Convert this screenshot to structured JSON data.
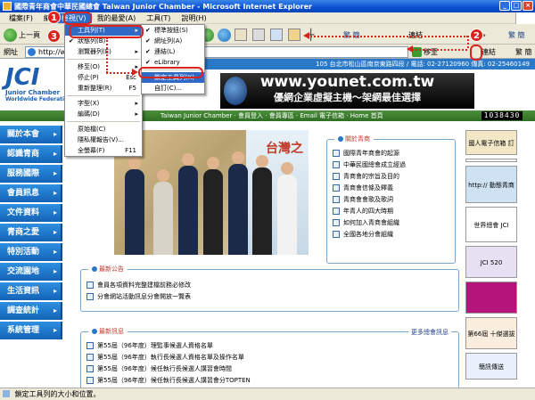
{
  "window": {
    "title": "國際青年商會中華民國總會 Taiwan Junior Chamber - Microsoft Internet Explorer",
    "controls": [
      "_",
      "□",
      "×"
    ]
  },
  "menubar": {
    "items": [
      "檔案(F)",
      "編",
      "檢視(V)",
      "我的最愛(A)",
      "工具(T)",
      "說明(H)"
    ]
  },
  "toolbar": {
    "back_label": "上一頁",
    "links_label": "連結",
    "extra_label": "繁 簡"
  },
  "address_bar": {
    "label": "網址",
    "url": "http://www",
    "go_label": "移至",
    "links_label": "連結",
    "links_extra": "繁 簡"
  },
  "view_menu": {
    "items": [
      {
        "label": "工具列(T)",
        "arrow": true,
        "highlighted": true
      },
      {
        "label": "狀態列(B)",
        "check": true
      },
      {
        "label": "瀏覽器列(E)",
        "arrow": true
      },
      {
        "sep": true
      },
      {
        "label": "移至(O)",
        "arrow": true
      },
      {
        "label": "停止(P)",
        "shortcut": "Esc"
      },
      {
        "label": "重新整理(R)",
        "shortcut": "F5"
      },
      {
        "sep": true
      },
      {
        "label": "字型(X)",
        "arrow": true
      },
      {
        "label": "編碼(D)",
        "arrow": true
      },
      {
        "sep": true
      },
      {
        "label": "原始檔(C)"
      },
      {
        "label": "隱私權報告(V)..."
      },
      {
        "label": "全螢幕(F)",
        "shortcut": "F11"
      }
    ]
  },
  "toolbars_submenu": {
    "items": [
      {
        "label": "標準按鈕(S)",
        "check": true
      },
      {
        "label": "網址列(A)",
        "check": true
      },
      {
        "label": "連結(L)",
        "check": true
      },
      {
        "label": "eLibrary",
        "check": true
      },
      {
        "sep": true
      },
      {
        "label": "鎖定工具列(K)",
        "highlighted": true
      },
      {
        "label": "自訂(C)..."
      }
    ]
  },
  "site": {
    "logo_letters": "JCI",
    "logo_sub1": "Junior Chamber",
    "logo_sub2": "Worldwide Federation",
    "address_strip": "105 台北市松山區南京東路四段 / 電話: 02-27120960  傳真: 02-25460149",
    "banner_line1": "www.younet.com.tw",
    "banner_line2": "優網企業虛擬主機～架網最佳選擇",
    "nav_text": "Taiwan Junior Chamber ‧ 會員登入 ‧ 會員專區 ‧ Email 電子信箱 ‧ Home 首頁",
    "counter": "1038430",
    "side_nav": [
      "關於本會",
      "認識青商",
      "服務國際",
      "會員訊息",
      "文件資料",
      "青商之愛",
      "特別活動",
      "交流園地",
      "生活資訊",
      "調查統計",
      "系統管理"
    ],
    "photo_backdrop_text": "台灣之",
    "about_panel": {
      "title": "關於青商",
      "rows": [
        "國際青年商會的起源",
        "中華民國總會成立經過",
        "青商會的宗旨及目的",
        "青商會信條及釋義",
        "青商會會歌及歌詞",
        "年青人的四大時期",
        "如何加入青商會組織",
        "全國各地分會組織"
      ]
    },
    "notice_panel": {
      "title": "最新公告",
      "rows": [
        "會員各項資料完整建檔前務必修改",
        "分會網站活動訊息分會開放一覽表"
      ]
    },
    "news_panel": {
      "title": "最新訊息",
      "more": "更多總會訊息",
      "rows": [
        "第55屆（96年度）理監事候選人資格名單",
        "第55屆（96年度）執行長候選人資格名單及操作名單",
        "第55屆（96年度）候任執行長候選人講習會時間",
        "第55屆（96年度）候任執行長候選人講習會分TOPTEN"
      ]
    },
    "right_ads": [
      {
        "label": "國人電子信箱 訂 閱 網 路",
        "bg": "#f4e7c8",
        "h": 28
      },
      {
        "label": "",
        "bg": "#f6f6f6",
        "h": 4
      },
      {
        "label": "http://  動態青商網路",
        "bg": "#cfe2f4",
        "h": 42
      },
      {
        "label": "世界總會 JCI",
        "bg": "#ffffff",
        "h": 40
      },
      {
        "label": "JCI 520",
        "bg": "#e6e0f2",
        "h": 36
      },
      {
        "label": "",
        "bg": "#b5157a",
        "h": 36
      },
      {
        "label": "第66屆 十傑選拔",
        "bg": "#fbeede",
        "h": 36
      },
      {
        "label": "簡訊傳送",
        "bg": "#e8f1fb",
        "h": 30
      }
    ]
  },
  "status_bar": {
    "text": "鎖定工具列的大小和位置。"
  },
  "annotations": {
    "step1": "1",
    "step2": "2",
    "step3": "3"
  },
  "colors": {
    "accent": "#316ac5",
    "annotation": "#d8241c",
    "site_blue": "#1c5fae",
    "site_green": "#2f6f24"
  }
}
